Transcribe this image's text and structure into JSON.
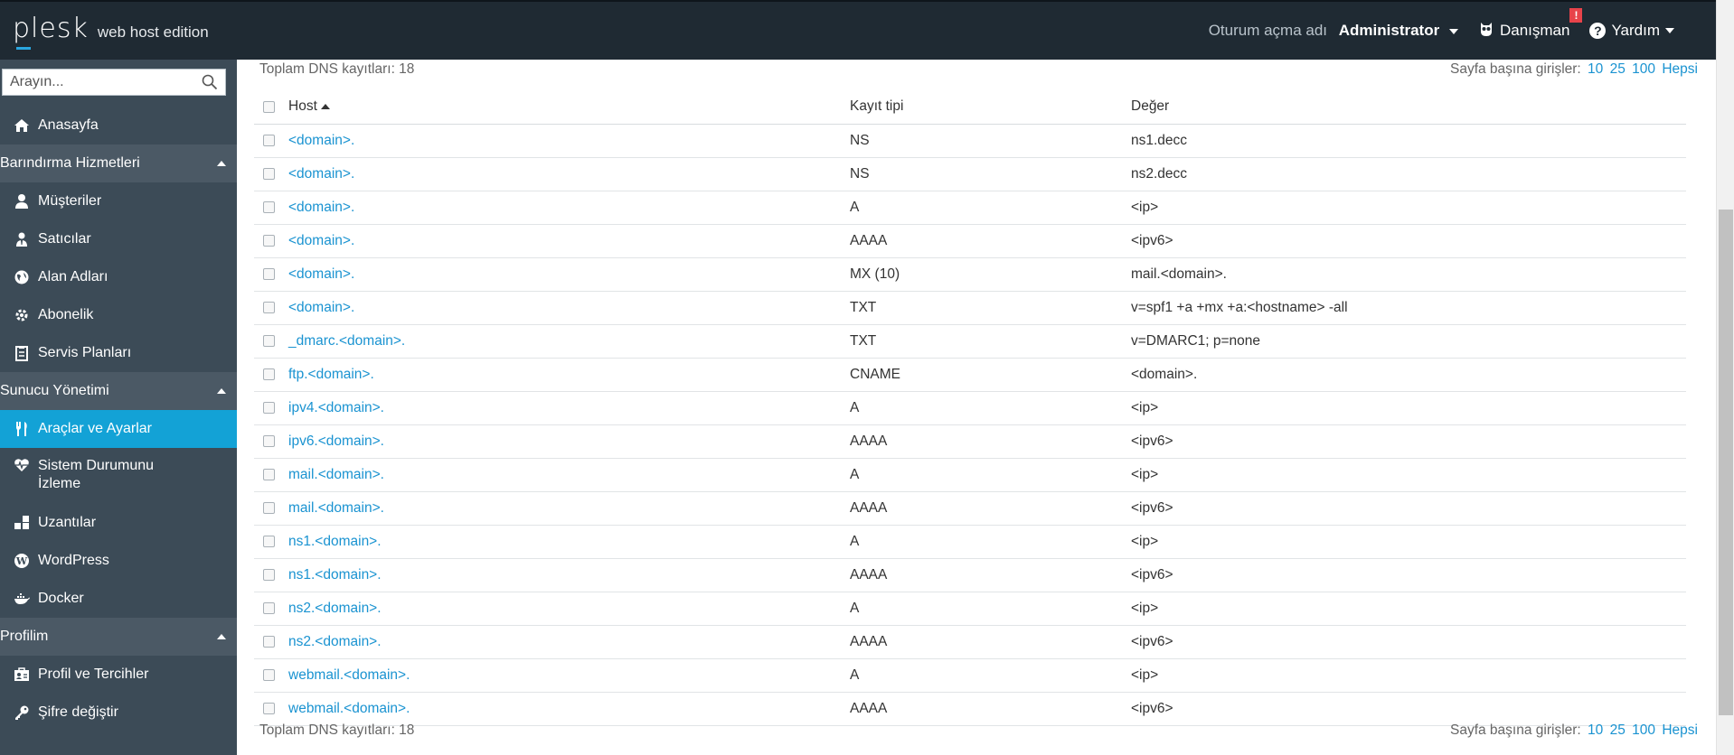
{
  "header": {
    "logo_main": "plesk",
    "logo_sub": "web host edition",
    "login_label": "Oturum açma adı",
    "login_user": "Administrator",
    "advisor_label": "Danışman",
    "advisor_badge": "!",
    "help_label": "Yardım"
  },
  "sidebar": {
    "search_placeholder": "Arayın...",
    "items": [
      {
        "type": "item",
        "label": "Anasayfa",
        "icon": "home-icon"
      },
      {
        "type": "section",
        "label": "Barındırma Hizmetleri"
      },
      {
        "type": "item",
        "label": "Müşteriler",
        "icon": "user-icon"
      },
      {
        "type": "item",
        "label": "Satıcılar",
        "icon": "reseller-icon"
      },
      {
        "type": "item",
        "label": "Alan Adları",
        "icon": "globe-icon"
      },
      {
        "type": "item",
        "label": "Abonelik",
        "icon": "gear-icon"
      },
      {
        "type": "item",
        "label": "Servis Planları",
        "icon": "plan-icon"
      },
      {
        "type": "section",
        "label": "Sunucu Yönetimi"
      },
      {
        "type": "item",
        "label": "Araçlar ve Ayarlar",
        "icon": "tools-icon",
        "active": true
      },
      {
        "type": "item",
        "label": "Sistem Durumunu İzleme",
        "icon": "heartbeat-icon",
        "two_line": true
      },
      {
        "type": "item",
        "label": "Uzantılar",
        "icon": "extensions-icon"
      },
      {
        "type": "item",
        "label": "WordPress",
        "icon": "wordpress-icon"
      },
      {
        "type": "item",
        "label": "Docker",
        "icon": "docker-icon"
      },
      {
        "type": "section",
        "label": "Profilim"
      },
      {
        "type": "item",
        "label": "Profil ve Tercihler",
        "icon": "profile-icon"
      },
      {
        "type": "item",
        "label": "Şifre değiştir",
        "icon": "key-icon"
      }
    ]
  },
  "main": {
    "total_text": "Toplam DNS kayıtları: 18",
    "perpage_label": "Sayfa başına girişler:",
    "perpage_options": [
      "10",
      "25",
      "100",
      "Hepsi"
    ],
    "columns": {
      "host": "Host",
      "type": "Kayıt tipi",
      "value": "Değer"
    },
    "rows": [
      {
        "host": "<domain>.",
        "type": "NS",
        "value": "ns1.decc",
        "clipped": true
      },
      {
        "host": "<domain>.",
        "type": "NS",
        "value": "ns2.decc",
        "clipped": true
      },
      {
        "host": "<domain>.",
        "type": "A",
        "value": "<ip>"
      },
      {
        "host": "<domain>.",
        "type": "AAAA",
        "value": "<ipv6>"
      },
      {
        "host": "<domain>.",
        "type": "MX (10)",
        "value": "mail.<domain>."
      },
      {
        "host": "<domain>.",
        "type": "TXT",
        "value": "v=spf1 +a +mx +a:<hostname> -all"
      },
      {
        "host": "_dmarc.<domain>.",
        "type": "TXT",
        "value": "v=DMARC1; p=none"
      },
      {
        "host": "ftp.<domain>.",
        "type": "CNAME",
        "value": "<domain>."
      },
      {
        "host": "ipv4.<domain>.",
        "type": "A",
        "value": "<ip>"
      },
      {
        "host": "ipv6.<domain>.",
        "type": "AAAA",
        "value": "<ipv6>"
      },
      {
        "host": "mail.<domain>.",
        "type": "A",
        "value": "<ip>"
      },
      {
        "host": "mail.<domain>.",
        "type": "AAAA",
        "value": "<ipv6>"
      },
      {
        "host": "ns1.<domain>.",
        "type": "A",
        "value": "<ip>"
      },
      {
        "host": "ns1.<domain>.",
        "type": "AAAA",
        "value": "<ipv6>"
      },
      {
        "host": "ns2.<domain>.",
        "type": "A",
        "value": "<ip>"
      },
      {
        "host": "ns2.<domain>.",
        "type": "AAAA",
        "value": "<ipv6>"
      },
      {
        "host": "webmail.<domain>.",
        "type": "A",
        "value": "<ip>"
      },
      {
        "host": "webmail.<domain>.",
        "type": "AAAA",
        "value": "<ipv6>"
      }
    ]
  },
  "colors": {
    "topbar": "#1f2a33",
    "sidebar": "#3c4b57",
    "sidebar_section": "#4b5965",
    "active": "#13a2d6",
    "link": "#1a93d1"
  }
}
